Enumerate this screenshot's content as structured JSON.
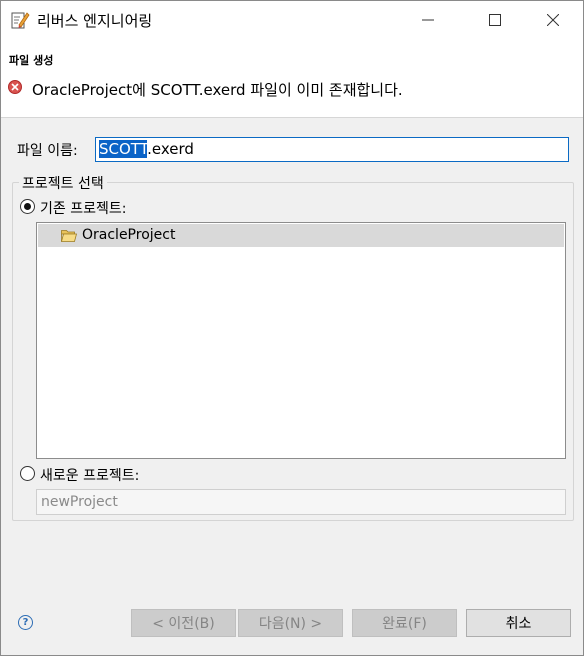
{
  "window": {
    "title": "리버스 엔지니어링",
    "icons": {
      "app": "edit-document-icon",
      "minimize": "minimize-icon",
      "maximize": "maximize-icon",
      "close": "close-icon"
    }
  },
  "banner": {
    "title": "파일 생성",
    "message": "OracleProject에 SCOTT.exerd 파일이 이미 존재합니다.",
    "icon": "error-icon"
  },
  "file_name": {
    "label": "파일 이름:",
    "value_selected": "SCOTT",
    "value_rest": ".exerd"
  },
  "project_group": {
    "label": "프로젝트 선택",
    "existing": {
      "label": "기존 프로젝트:",
      "checked": true,
      "items": [
        {
          "label": "OracleProject",
          "icon": "open-folder-icon",
          "selected": true
        }
      ]
    },
    "new": {
      "label": "새로운 프로젝트:",
      "checked": false,
      "value": "newProject"
    }
  },
  "buttons": {
    "help_icon": "help-icon",
    "help_glyph": "?",
    "back": "< 이전(B)",
    "next": "다음(N) >",
    "finish": "완료(F)",
    "cancel": "취소"
  },
  "colors": {
    "selection": "#0a63c7",
    "error": "#d9534f",
    "input_border": "#0b6ac4"
  }
}
